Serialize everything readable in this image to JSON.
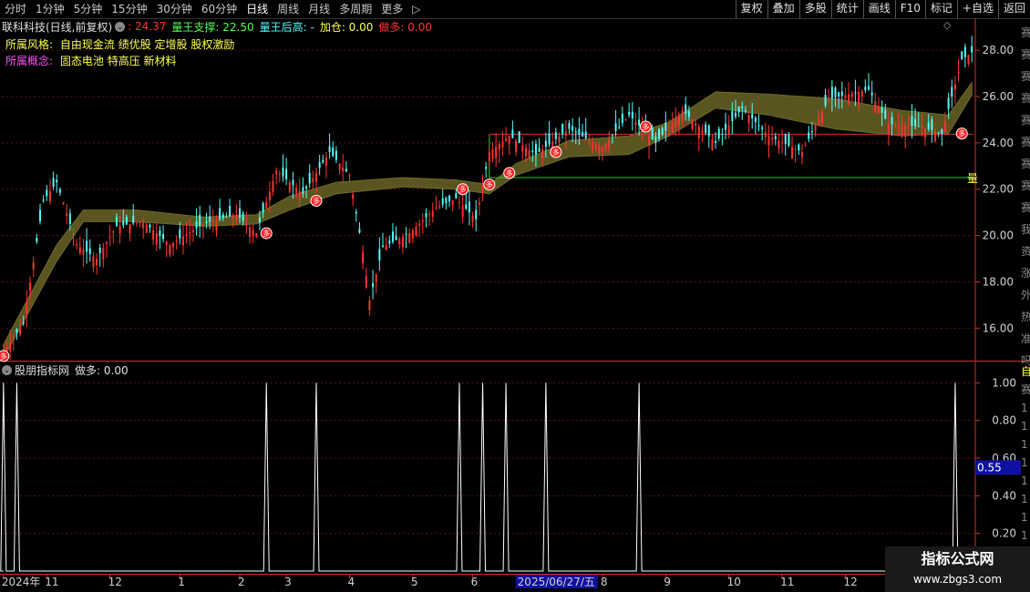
{
  "toolbar": {
    "periods": [
      "分时",
      "1分钟",
      "5分钟",
      "15分钟",
      "30分钟",
      "60分钟",
      "日线",
      "周线",
      "月线",
      "多周期",
      "更多"
    ],
    "active_period": "日线",
    "more_arrow": "▷",
    "buttons": [
      "复权",
      "叠加",
      "多股",
      "统计",
      "画线",
      "F10",
      "标记",
      "+自选",
      "返回"
    ]
  },
  "main_info": {
    "title": "联科科技(日线,前复权)",
    "value1": ": 24.37",
    "support": "量王支撑: 22.50",
    "high": "量王后高: -",
    "add": "加仓: 0.00",
    "long": "做多: 0.00"
  },
  "style_row": {
    "label": "所属风格:",
    "value": "自由现金流 绩优股 定增股 股权激励"
  },
  "concept_row": {
    "label": "所属概念:",
    "value": "固态电池 特高压 新材料"
  },
  "sub_info": {
    "title": "股朋指标网",
    "long": "做多: 0.00"
  },
  "colors": {
    "up": "#ff3232",
    "down": "#54fcfc",
    "band": "#5a5520",
    "support": "#28c828",
    "resistance": "#c83232",
    "axis": "#c83232",
    "grid": "#5a1414",
    "label_yellow": "#ffff54",
    "label_magenta": "#ff54ff"
  },
  "right_edge": {
    "support_marker": "量",
    "sub_badge": "自",
    "side_glyphs": [
      "赛",
      "赛",
      "赛",
      "赛",
      "赛",
      "赛",
      "赛",
      "赛",
      "赛",
      "我",
      "资",
      "涨",
      "外",
      "热",
      "准",
      "吗"
    ],
    "sub_glyphs": [
      "赛",
      "1",
      "1",
      "1",
      "1",
      "1",
      "1",
      "1",
      "1"
    ]
  },
  "signal_glyph": "多",
  "chart_data": [
    {
      "type": "candlestick",
      "ylim": [
        14.6,
        29.3
      ],
      "y_ticks": [
        16.0,
        18.0,
        20.0,
        22.0,
        24.0,
        26.0,
        28.0
      ],
      "y_tick_labels": [
        "16.00",
        "18.00",
        "20.00",
        "22.00",
        "24.00",
        "26.00",
        "28.00"
      ],
      "x_labels": [
        "2024年",
        "11",
        "12",
        "1",
        "2",
        "3",
        "4",
        "5",
        "6",
        "2025/06/27/五",
        "8",
        "9",
        "10",
        "11",
        "12"
      ],
      "x_label_positions": [
        0,
        13,
        32,
        53,
        71,
        85,
        104,
        123,
        141,
        155,
        180,
        199,
        218,
        234,
        253
      ],
      "num_candles": 292,
      "support_line": 22.5,
      "resistance_line": 24.37,
      "price_path": [
        [
          0,
          15.0
        ],
        [
          6,
          16.2
        ],
        [
          12,
          21.5
        ],
        [
          16,
          22.3
        ],
        [
          22,
          19.6
        ],
        [
          28,
          19.0
        ],
        [
          34,
          20.4
        ],
        [
          42,
          20.6
        ],
        [
          50,
          19.6
        ],
        [
          60,
          20.5
        ],
        [
          70,
          20.9
        ],
        [
          76,
          20.1
        ],
        [
          82,
          22.8
        ],
        [
          90,
          21.8
        ],
        [
          98,
          23.6
        ],
        [
          104,
          22.6
        ],
        [
          108,
          19.3
        ],
        [
          110,
          17.2
        ],
        [
          114,
          19.5
        ],
        [
          122,
          20.1
        ],
        [
          130,
          21.2
        ],
        [
          136,
          21.6
        ],
        [
          142,
          20.7
        ],
        [
          146,
          23.6
        ],
        [
          152,
          24.3
        ],
        [
          160,
          23.5
        ],
        [
          170,
          24.6
        ],
        [
          180,
          23.8
        ],
        [
          188,
          25.2
        ],
        [
          196,
          24.0
        ],
        [
          204,
          25.4
        ],
        [
          214,
          24.0
        ],
        [
          222,
          25.5
        ],
        [
          230,
          24.3
        ],
        [
          240,
          23.6
        ],
        [
          248,
          25.9
        ],
        [
          260,
          26.3
        ],
        [
          266,
          24.8
        ],
        [
          276,
          24.7
        ],
        [
          282,
          24.4
        ],
        [
          288,
          27.6
        ],
        [
          292,
          28.0
        ]
      ],
      "band_upper": [
        [
          0,
          15.3
        ],
        [
          16,
          19.6
        ],
        [
          24,
          21.1
        ],
        [
          40,
          21.1
        ],
        [
          60,
          20.8
        ],
        [
          76,
          20.9
        ],
        [
          86,
          21.7
        ],
        [
          100,
          22.3
        ],
        [
          120,
          22.5
        ],
        [
          136,
          22.4
        ],
        [
          146,
          22.2
        ],
        [
          154,
          23.1
        ],
        [
          170,
          24.1
        ],
        [
          188,
          24.3
        ],
        [
          200,
          24.9
        ],
        [
          214,
          26.2
        ],
        [
          230,
          26.1
        ],
        [
          250,
          25.9
        ],
        [
          270,
          25.4
        ],
        [
          284,
          25.2
        ],
        [
          292,
          26.8
        ]
      ],
      "band_lower": [
        [
          0,
          14.7
        ],
        [
          16,
          18.9
        ],
        [
          24,
          20.6
        ],
        [
          40,
          20.6
        ],
        [
          60,
          20.4
        ],
        [
          76,
          20.5
        ],
        [
          86,
          21.1
        ],
        [
          100,
          21.8
        ],
        [
          120,
          22.1
        ],
        [
          136,
          22.0
        ],
        [
          146,
          21.8
        ],
        [
          154,
          22.6
        ],
        [
          170,
          23.4
        ],
        [
          188,
          23.5
        ],
        [
          200,
          24.3
        ],
        [
          214,
          25.5
        ],
        [
          230,
          25.2
        ],
        [
          250,
          24.6
        ],
        [
          270,
          24.3
        ],
        [
          284,
          24.4
        ],
        [
          292,
          26.3
        ]
      ],
      "signals": [
        [
          0,
          14.8
        ],
        [
          79,
          20.1
        ],
        [
          94,
          21.5
        ],
        [
          138,
          22.0
        ],
        [
          146,
          22.2
        ],
        [
          152,
          22.7
        ],
        [
          166,
          23.6
        ],
        [
          193,
          24.7
        ],
        [
          288,
          24.4
        ]
      ]
    },
    {
      "type": "spike",
      "ylim": [
        0,
        1.05
      ],
      "y_ticks": [
        1.0,
        0.8,
        0.6,
        0.4,
        0.2
      ],
      "y_tick_labels": [
        "1.00",
        "0.80",
        "0.60",
        "0.40",
        "0.20"
      ],
      "cursor_label": "0.55",
      "spikes_at": [
        0,
        4,
        79,
        94,
        137,
        144,
        151,
        163,
        191,
        286
      ]
    }
  ]
}
